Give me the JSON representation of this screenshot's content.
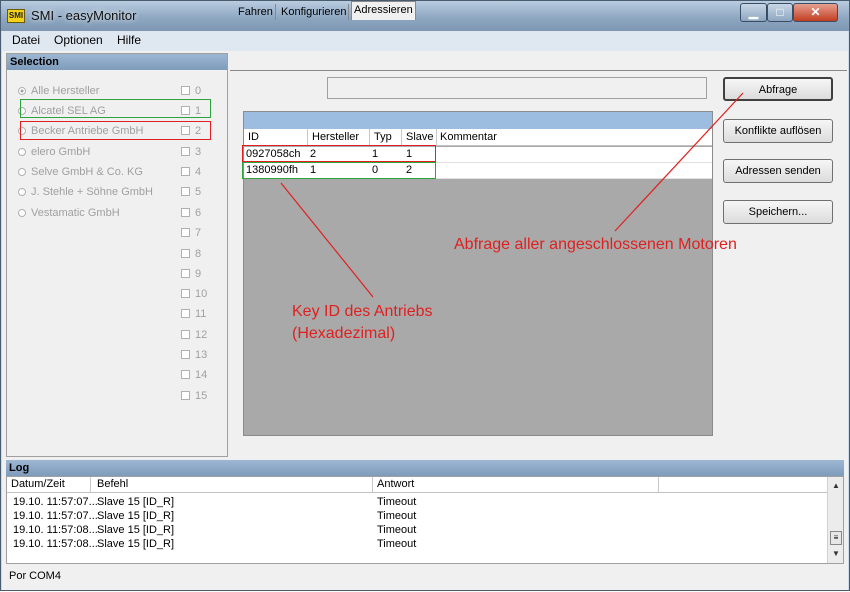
{
  "window": {
    "title": "SMI - easyMonitor",
    "app_icon": "smi-logo-icon",
    "minimize": "▁",
    "maximize": "□",
    "close": "✕"
  },
  "menu": [
    "Datei",
    "Optionen",
    "Hilfe"
  ],
  "selection": {
    "header": "Selection",
    "manufacturers": [
      "Alle Hersteller",
      "Alcatel SEL AG",
      "Becker Antriebe GmbH",
      "elero GmbH",
      "Selve GmbH & Co. KG",
      "J. Stehle + Söhne GmbH",
      "Vestamatic GmbH"
    ],
    "checkbox_labels": [
      "0",
      "1",
      "2",
      "3",
      "4",
      "5",
      "6",
      "7",
      "8",
      "9",
      "10",
      "11",
      "12",
      "13",
      "14",
      "15"
    ]
  },
  "tabs": [
    "Fahren",
    "Konfigurieren",
    "Adressieren"
  ],
  "grid": {
    "columns": [
      "ID",
      "Hersteller",
      "Typ",
      "Slave",
      "Kommentar"
    ],
    "rows": [
      [
        "0927058ch",
        "2",
        "1",
        "1",
        ""
      ],
      [
        "1380990fh",
        "1",
        "0",
        "2",
        ""
      ]
    ]
  },
  "buttons": [
    "Abfrage",
    "Konflikte auflösen",
    "Adressen senden",
    "Speichern..."
  ],
  "annotations": {
    "abfrage": "Abfrage aller angeschlossenen Motoren",
    "key_id_line1": "Key ID des Antriebs",
    "key_id_line2": "(Hexadezimal)",
    "color": "#e02020"
  },
  "log": {
    "header": "Log",
    "columns": [
      "Datum/Zeit",
      "Befehl",
      "Antwort"
    ],
    "rows": [
      [
        "19.10. 11:57:07...",
        "Slave 15 [ID_R]",
        "Timeout"
      ],
      [
        "19.10. 11:57:07...",
        "Slave 15 [ID_R]",
        "Timeout"
      ],
      [
        "19.10. 11:57:08...",
        "Slave 15 [ID_R]",
        "Timeout"
      ],
      [
        "19.10. 11:57:08...",
        "Slave 15 [ID_R]",
        "Timeout"
      ]
    ]
  },
  "status": {
    "port": "Por COM4"
  }
}
